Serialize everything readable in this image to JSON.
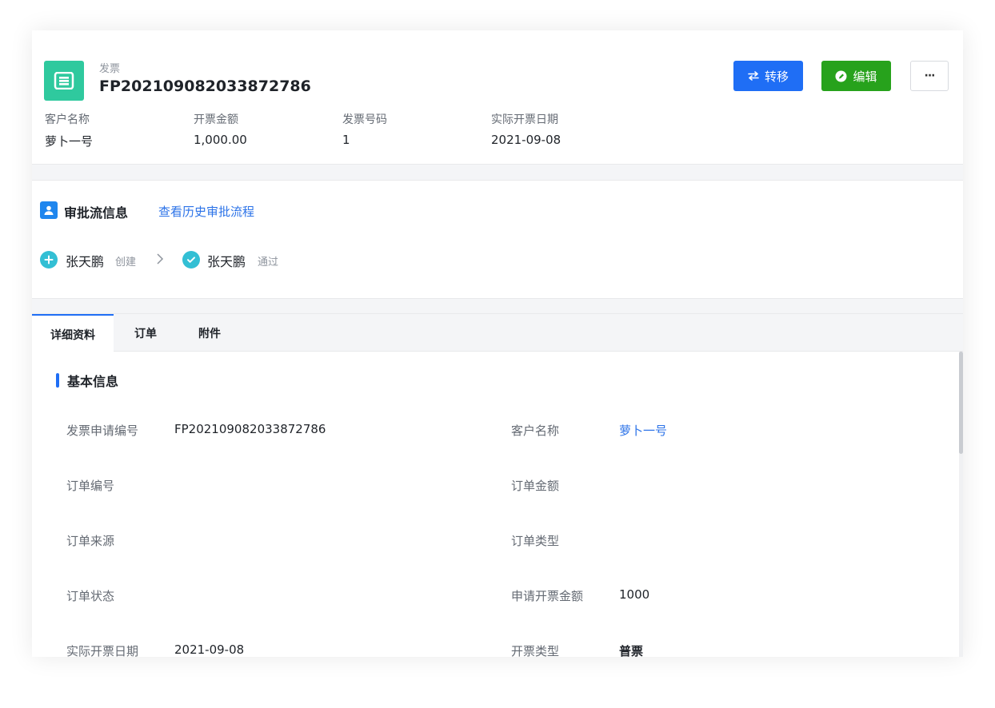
{
  "header": {
    "doc_type": "发票",
    "doc_number": "FP20210908203387278​6",
    "buttons": {
      "transfer": "转移",
      "edit": "编辑",
      "more": "···"
    },
    "fields": [
      {
        "label": "客户名称",
        "value": "萝卜一号"
      },
      {
        "label": "开票金额",
        "value": "1,000.00"
      },
      {
        "label": "发票号码",
        "value": "1"
      },
      {
        "label": "实际开票日期",
        "value": "2021-09-08"
      }
    ]
  },
  "approval": {
    "title": "审批流信息",
    "history_link": "查看历史审批流程",
    "steps": [
      {
        "name": "张天鹏",
        "action": "创建",
        "icon": "plus-circle-icon"
      },
      {
        "name": "张天鹏",
        "action": "通过",
        "icon": "check-circle-icon"
      }
    ]
  },
  "tabs": [
    "详细资料",
    "订单",
    "附件"
  ],
  "active_tab": "详细资料",
  "details": {
    "section_title": "基本信息",
    "rows": [
      {
        "left_label": "发票申请编号",
        "left_value": "FP20210908203387278​6",
        "right_label": "客户名称",
        "right_value": "萝卜一号"
      },
      {
        "left_label": "订单编号",
        "left_value": "",
        "right_label": "订单金额",
        "right_value": ""
      },
      {
        "left_label": "订单来源",
        "left_value": "",
        "right_label": "订单类型",
        "right_value": ""
      },
      {
        "left_label": "订单状态",
        "left_value": "",
        "right_label": "申请开票金额",
        "right_value": "1000"
      },
      {
        "left_label": "实际开票日期",
        "left_value": "2021-09-08",
        "right_label": "开票类型",
        "right_value": "普票"
      }
    ]
  },
  "colors": {
    "primary": "#1f6ef5",
    "success": "#27a21c",
    "doc_icon": "#2fc99e",
    "link": "#2c73e8",
    "step": "#33bfd4"
  }
}
